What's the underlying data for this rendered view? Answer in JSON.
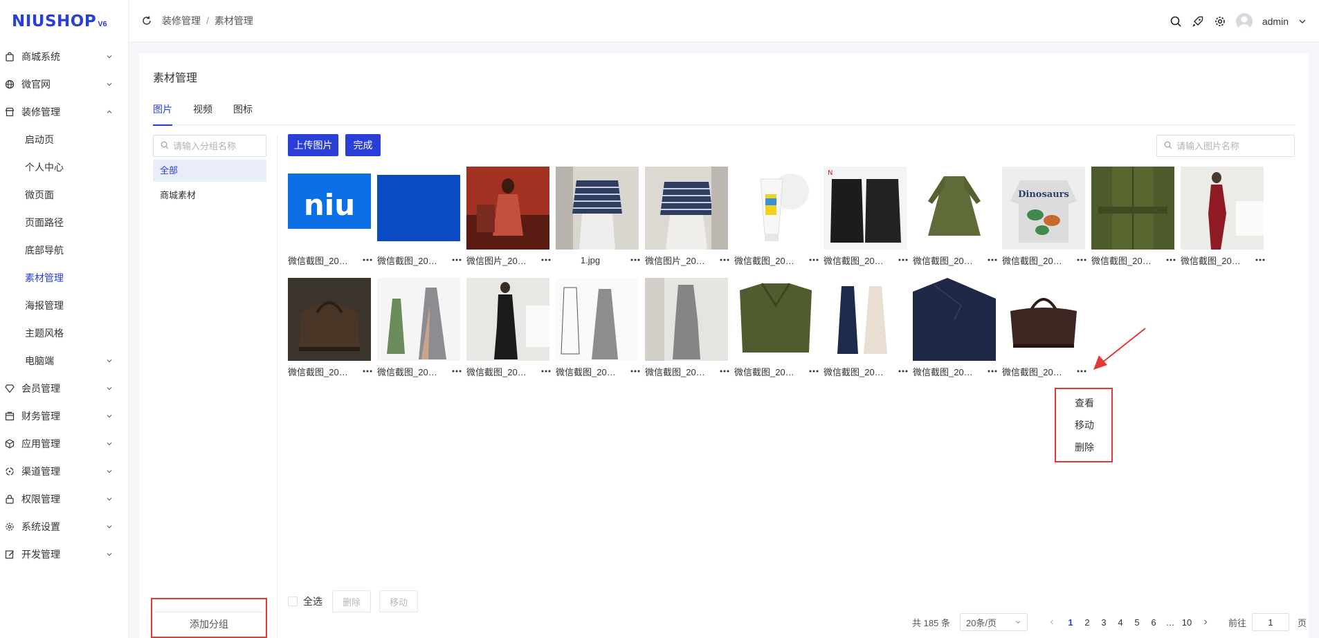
{
  "logo": {
    "text": "NIUSHOP",
    "version": "V6"
  },
  "sidebar": {
    "items": [
      {
        "label": "商城系统",
        "icon": "bag-icon",
        "expanded": false
      },
      {
        "label": "微官网",
        "icon": "globe-icon",
        "expanded": false
      },
      {
        "label": "装修管理",
        "icon": "shop-icon",
        "expanded": true
      },
      {
        "label": "会员管理",
        "icon": "diamond-icon",
        "expanded": false
      },
      {
        "label": "财务管理",
        "icon": "finance-icon",
        "expanded": false
      },
      {
        "label": "应用管理",
        "icon": "cube-icon",
        "expanded": false
      },
      {
        "label": "渠道管理",
        "icon": "channel-icon",
        "expanded": false
      },
      {
        "label": "权限管理",
        "icon": "lock-icon",
        "expanded": false
      },
      {
        "label": "系统设置",
        "icon": "gear-icon",
        "expanded": false
      },
      {
        "label": "开发管理",
        "icon": "edit-icon",
        "expanded": false
      }
    ],
    "sub_items": [
      {
        "label": "启动页",
        "active": false
      },
      {
        "label": "个人中心",
        "active": false
      },
      {
        "label": "微页面",
        "active": false
      },
      {
        "label": "页面路径",
        "active": false
      },
      {
        "label": "底部导航",
        "active": false
      },
      {
        "label": "素材管理",
        "active": true
      },
      {
        "label": "海报管理",
        "active": false
      },
      {
        "label": "主题风格",
        "active": false
      },
      {
        "label": "电脑端",
        "active": false,
        "has_arrow": true
      }
    ]
  },
  "header": {
    "breadcrumb": [
      "装修管理",
      "素材管理"
    ],
    "user": "admin"
  },
  "page": {
    "title": "素材管理",
    "tabs": [
      "图片",
      "视频",
      "图标"
    ],
    "active_tab": 0
  },
  "groups": {
    "search_placeholder": "请输入分组名称",
    "items": [
      "全部",
      "商城素材"
    ],
    "active": 0,
    "add_label": "添加分组"
  },
  "toolbar": {
    "upload_label": "上传图片",
    "done_label": "完成",
    "search_placeholder": "请输入图片名称"
  },
  "images": [
    {
      "name": "微信截图_20…",
      "thumb": "niu-logo"
    },
    {
      "name": "微信截图_20…",
      "thumb": "blue-square"
    },
    {
      "name": "微信图片_20…",
      "thumb": "red-dress"
    },
    {
      "name": "1.jpg",
      "thumb": "striped-top-a"
    },
    {
      "name": "微信图片_20…",
      "thumb": "striped-top-b"
    },
    {
      "name": "微信截图_20…",
      "thumb": "cosmetic-tube"
    },
    {
      "name": "微信截图_20…",
      "thumb": "black-outfit"
    },
    {
      "name": "微信截图_20…",
      "thumb": "green-dress"
    },
    {
      "name": "微信截图_20…",
      "thumb": "dinosaur-sweater"
    },
    {
      "name": "微信截图_20…",
      "thumb": "green-detail"
    },
    {
      "name": "微信截图_20…",
      "thumb": "red-gown"
    },
    {
      "name": "微信截图_20…",
      "thumb": "leather-bag"
    },
    {
      "name": "微信截图_20…",
      "thumb": "silver-gown"
    },
    {
      "name": "微信截图_20…",
      "thumb": "black-gown"
    },
    {
      "name": "微信截图_20…",
      "thumb": "grey-sketch"
    },
    {
      "name": "微信截图_20…",
      "thumb": "grey-dress"
    },
    {
      "name": "微信截图_20…",
      "thumb": "green-jacket"
    },
    {
      "name": "微信截图_20…",
      "thumb": "two-dresses"
    },
    {
      "name": "微信截图_20…",
      "thumb": "navy-dress"
    },
    {
      "name": "微信截图_20…",
      "thumb": "brown-bag"
    }
  ],
  "context_menu": {
    "items": [
      "查看",
      "移动",
      "删除"
    ]
  },
  "bottom": {
    "select_all": "全选",
    "delete_label": "删除",
    "move_label": "移动"
  },
  "pagination": {
    "total_text": "共 185 条",
    "page_size": "20条/页",
    "pages": [
      "1",
      "2",
      "3",
      "4",
      "5",
      "6",
      "…",
      "10"
    ],
    "current": 1,
    "goto_label": "前往",
    "goto_value": "1",
    "page_suffix": "页"
  },
  "colors": {
    "primary": "#2a3fd8",
    "highlight": "#e53935"
  }
}
